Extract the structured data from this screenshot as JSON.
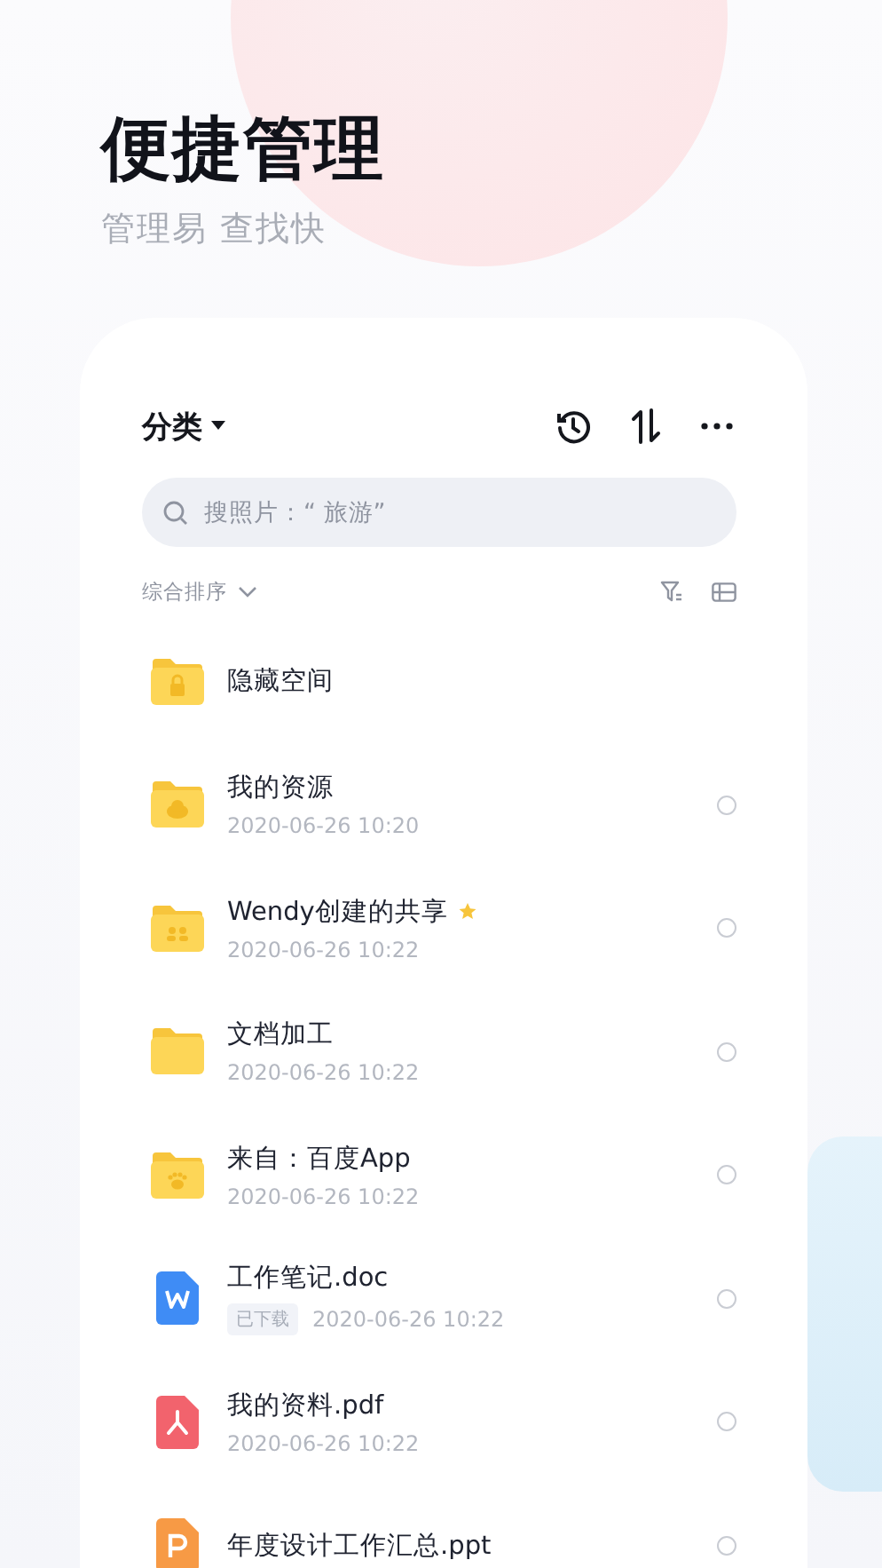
{
  "hero": {
    "title": "便捷管理",
    "subtitle": "管理易 查找快"
  },
  "toolbar": {
    "title": "分类"
  },
  "search": {
    "placeholder": "搜照片：“ 旅游”"
  },
  "sort": {
    "label": "综合排序"
  },
  "files": [
    {
      "kind": "lock-folder",
      "name": "隐藏空间",
      "starred": false
    },
    {
      "kind": "cloud-folder",
      "name": "我的资源",
      "date": "2020-06-26  10:20",
      "starred": false,
      "selected": false
    },
    {
      "kind": "people-folder",
      "name": "Wendy创建的共享",
      "date": "2020-06-26  10:22",
      "starred": true,
      "selected": false
    },
    {
      "kind": "folder",
      "name": "文档加工",
      "date": "2020-06-26  10:22",
      "starred": false,
      "selected": false
    },
    {
      "kind": "paw-folder",
      "name": "来自：百度App",
      "date": "2020-06-26  10:22",
      "starred": false,
      "selected": false
    },
    {
      "kind": "doc",
      "name": "工作笔记.doc",
      "tag": "已下载",
      "date": "2020-06-26  10:22",
      "starred": false,
      "selected": false
    },
    {
      "kind": "pdf",
      "name": "我的资料.pdf",
      "date": "2020-06-26  10:22",
      "starred": false,
      "selected": false
    },
    {
      "kind": "ppt",
      "name": "年度设计工作汇总.ppt",
      "starred": false,
      "selected": false
    }
  ]
}
